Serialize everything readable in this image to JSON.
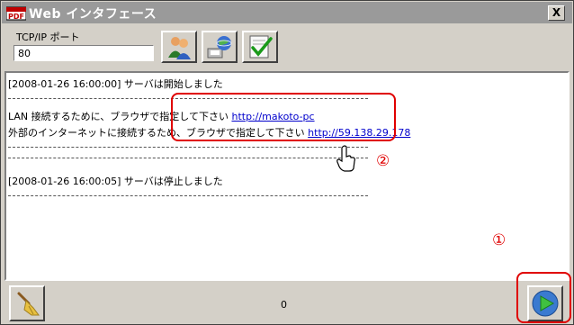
{
  "window": {
    "icon_text": "PDF",
    "title": "Web インタフェース",
    "close_label": "X"
  },
  "toolbar": {
    "port_label": "TCP/IP ポート",
    "port_value": "80",
    "buttons": [
      {
        "icon": "users-icon"
      },
      {
        "icon": "network-globe-icon"
      },
      {
        "icon": "checklist-icon"
      }
    ]
  },
  "log": {
    "line1": "[2008-01-26 16:00:00] サーバは開始しました",
    "line2_text": "LAN 接続するために、ブラウザで指定して下さい ",
    "line2_url": "http://makoto-pc",
    "line3_text": "外部のインターネットに接続するため、ブラウザで指定して下さい ",
    "line3_url": "http://59.138.29.178",
    "line4": "[2008-01-26 16:00:05] サーバは停止しました"
  },
  "annotations": {
    "marker1": "①",
    "marker2": "②",
    "color": "#e00000"
  },
  "bottom": {
    "clear_icon": "broom-icon",
    "counter": "0",
    "start_icon": "play-arrow-icon"
  }
}
